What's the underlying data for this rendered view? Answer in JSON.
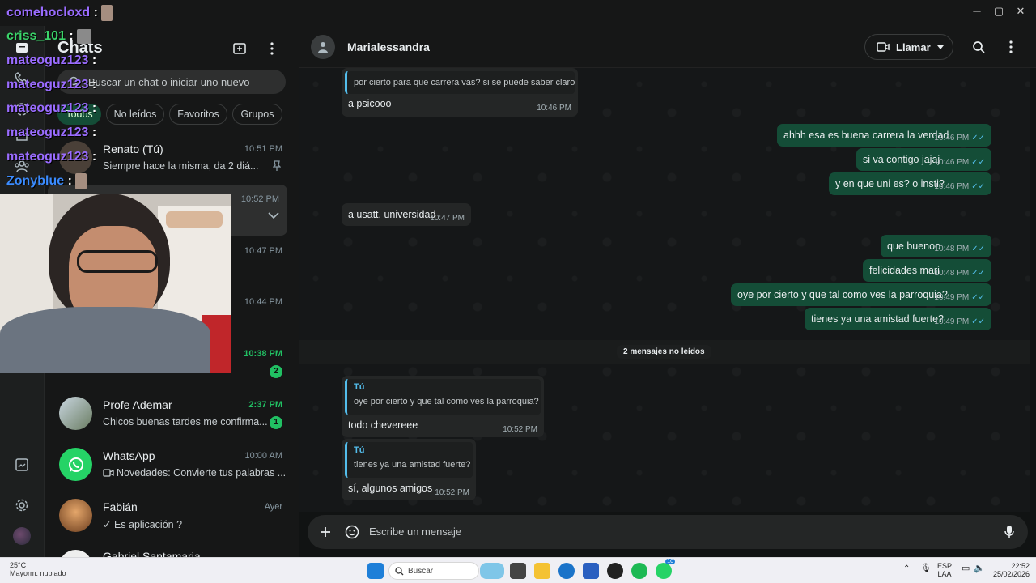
{
  "window": {
    "minimize": "─",
    "maximize": "▢",
    "close": "✕"
  },
  "rail": {
    "icons": [
      "chats-icon",
      "calls-icon",
      "status-icon",
      "channels-icon",
      "communities-icon",
      "media-icon",
      "settings-icon",
      "profile-avatar"
    ]
  },
  "chat_list": {
    "title": "Chats",
    "search_placeholder": "Buscar un chat o iniciar uno nuevo",
    "filters": [
      "Todos",
      "No leídos",
      "Favoritos",
      "Grupos"
    ],
    "rows": [
      {
        "name": "Renato (Tú)",
        "time": "10:51 PM",
        "preview": "Siempre hace la misma, da 2 diá...",
        "unread": ""
      },
      {
        "name": "",
        "time": "10:52 PM",
        "preview": "",
        "unread": ""
      },
      {
        "name": "",
        "time": "10:47 PM",
        "preview": "",
        "unread": ""
      },
      {
        "name": "",
        "time": "10:44 PM",
        "preview": "",
        "unread": ""
      },
      {
        "name": "",
        "time": "10:38 PM",
        "preview": "",
        "unread": "2"
      },
      {
        "name": "Profe Ademar",
        "time": "2:37 PM",
        "preview": "Chicos buenas tardes me confirma...",
        "unread": "1"
      },
      {
        "name": "WhatsApp",
        "time": "10:00 AM",
        "preview": "Novedades: Convierte tus palabras ...",
        "unread": ""
      },
      {
        "name": "Fabián",
        "time": "Ayer",
        "preview": "✓ Es aplicación ?",
        "unread": ""
      },
      {
        "name": "Gabriel Santamaria",
        "time": "",
        "preview": "",
        "unread": ""
      }
    ]
  },
  "conversation": {
    "contact": "Marialessandra",
    "call_label": "Llamar",
    "messages": [
      {
        "dir": "in",
        "quote": "por cierto para que carrera vas? si se puede saber claro",
        "text": "a psicooo",
        "time": "10:46 PM"
      },
      {
        "dir": "out",
        "text": "ahhh esa es buena carrera la verdad",
        "time": "10:46 PM"
      },
      {
        "dir": "out",
        "text": "si va contigo jajaj",
        "time": "10:46 PM"
      },
      {
        "dir": "out",
        "text": "y en que uni es? o insti?",
        "time": "10:46 PM"
      },
      {
        "dir": "in",
        "text": "a usatt, universidad",
        "time": "10:47 PM"
      },
      {
        "dir": "out",
        "text": "que buenoo",
        "time": "10:48 PM"
      },
      {
        "dir": "out",
        "text": "felicidades mari",
        "time": "10:48 PM"
      },
      {
        "dir": "out",
        "text": "oye por cierto y que tal como ves la parroquia?",
        "time": "10:49 PM"
      },
      {
        "dir": "out",
        "text": "tienes ya una amistad fuerte?",
        "time": "10:49 PM"
      },
      {
        "dir": "in",
        "quote_author": "Tú",
        "quote": "oye por cierto y que tal como ves la parroquia?",
        "text": "todo chevereee",
        "time": "10:52 PM"
      },
      {
        "dir": "in",
        "quote_author": "Tú",
        "quote": "tienes ya una amistad fuerte?",
        "text": "sí, algunos amigos",
        "time": "10:52 PM"
      }
    ],
    "unread_divider": "2 mensajes no leídos",
    "composer_placeholder": "Escribe un mensaje"
  },
  "stream_chat": [
    {
      "user": "comehocloxd",
      "colon": ":",
      "color": "purple"
    },
    {
      "user": "criss_101",
      "colon": ":",
      "color": "green"
    },
    {
      "user": "mateoguz123",
      "colon": ":",
      "color": "purple"
    },
    {
      "user": "mateoguz123",
      "colon": ":",
      "color": "purple"
    },
    {
      "user": "mateoguz123",
      "colon": ":",
      "color": "purple"
    },
    {
      "user": "mateoguz123",
      "colon": ":",
      "color": "purple"
    },
    {
      "user": "mateoguz123",
      "colon": ":",
      "color": "purple"
    },
    {
      "user": "Zonyblue",
      "colon": ":",
      "color": "blue"
    }
  ],
  "taskbar": {
    "temp": "25°C",
    "weather": "Mayorm. nublado",
    "search": "Buscar",
    "lang1": "ESP",
    "lang2": "LAA",
    "time": "22:52",
    "date": "25/02/2026",
    "whatsapp_badge": "10"
  },
  "colors": {
    "accent": "#21c063",
    "outgoing": "#144d37",
    "incoming": "#242626",
    "ticks": "#53bdeb"
  }
}
